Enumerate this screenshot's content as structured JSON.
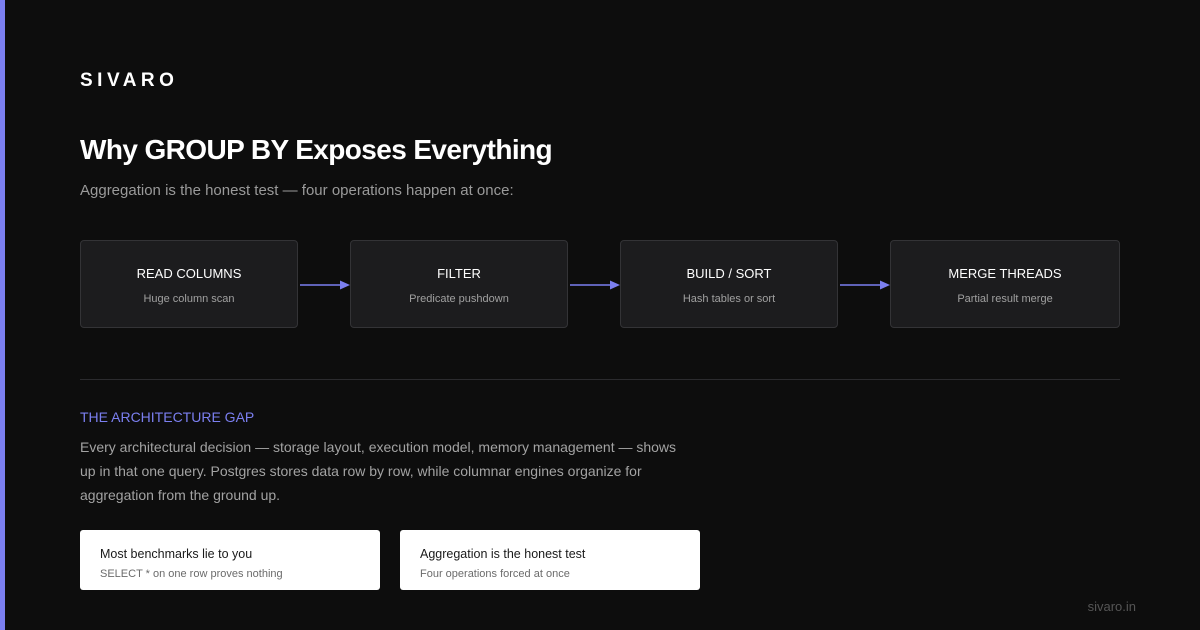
{
  "brand": "SIVARO",
  "title": "Why GROUP BY Exposes Everything",
  "subtitle": "Aggregation is the honest test — four operations happen at once:",
  "accent_color": "#7b7ff0",
  "steps": [
    {
      "title": "READ COLUMNS",
      "desc": "Huge column scan"
    },
    {
      "title": "FILTER",
      "desc": "Predicate pushdown"
    },
    {
      "title": "BUILD / SORT",
      "desc": "Hash tables or sort"
    },
    {
      "title": "MERGE THREADS",
      "desc": "Partial result merge"
    }
  ],
  "section": {
    "label": "THE ARCHITECTURE GAP",
    "body": "Every architectural decision — storage layout, execution model, memory management — shows up in that one query. Postgres stores data row by row, while columnar engines organize for aggregation from the ground up."
  },
  "cards": [
    {
      "title": "Most benchmarks lie to you",
      "desc": "SELECT * on one row proves nothing"
    },
    {
      "title": "Aggregation is the honest test",
      "desc": "Four operations forced at once"
    }
  ],
  "footer": "sivaro.in"
}
